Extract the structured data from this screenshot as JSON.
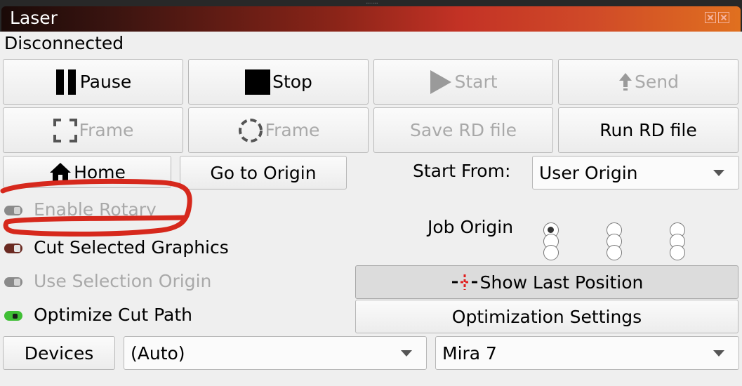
{
  "window": {
    "grip": "......",
    "title": "Laser"
  },
  "status": "Disconnected",
  "buttons": {
    "pause": "Pause",
    "stop": "Stop",
    "start": "Start",
    "send": "Send",
    "frame_rect": "Frame",
    "frame_circle": "Frame",
    "save_rd": "Save RD file",
    "run_rd": "Run RD file",
    "home": "Home",
    "go_origin": "Go to Origin",
    "show_last": "Show Last Position",
    "opt_settings": "Optimization Settings",
    "devices": "Devices"
  },
  "start_from": {
    "label": "Start From:",
    "value": "User Origin"
  },
  "job_origin": {
    "label": "Job Origin",
    "selected_index": 0
  },
  "options": {
    "enable_rotary": "Enable Rotary",
    "cut_selected": "Cut Selected Graphics",
    "use_sel_origin": "Use Selection Origin",
    "optimize_path": "Optimize Cut Path"
  },
  "port_combo": {
    "value": "(Auto)"
  },
  "device_combo": {
    "value": "Mira 7"
  },
  "colors": {
    "annotation": "#d6281c",
    "toggle_active": "#3fbe35",
    "toggle_selected": "#6a2a22"
  }
}
